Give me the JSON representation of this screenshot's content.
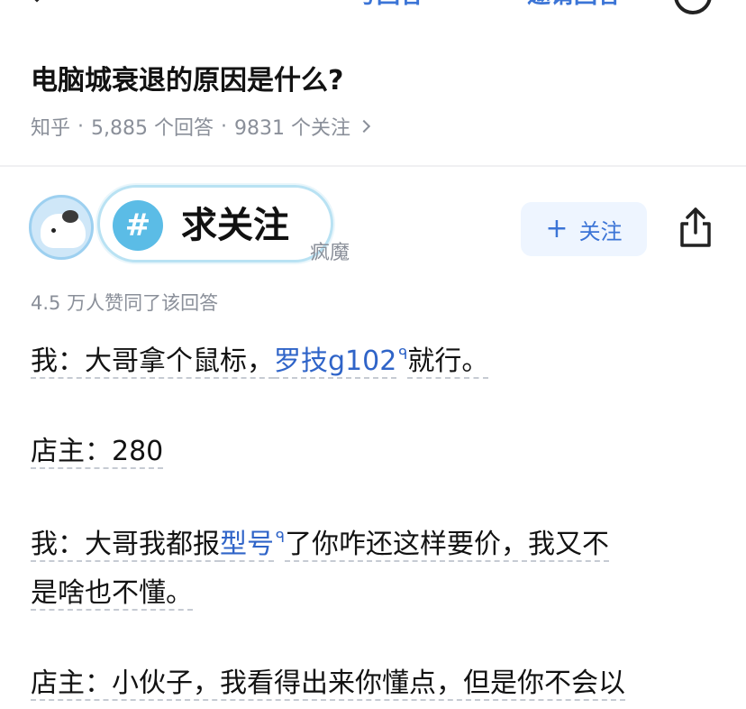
{
  "topbar": {
    "link1": "写回答",
    "link2": "邀请回答"
  },
  "question": {
    "title": "电脑城衰退的原因是什么?",
    "source": "知乎",
    "answers": "5,885 个回答",
    "followers": "9831 个关注"
  },
  "author": {
    "sticker_hash": "#",
    "sticker_text": "求关注",
    "name_suffix": "疯魔",
    "follow_label": "关注",
    "upvotes": "4.5 万人赞同了该回答"
  },
  "answer": {
    "p1_prefix": "我：大哥拿个鼠标，",
    "p1_link": "罗技g102",
    "p1_suffix": "就行。",
    "p2": "店主：280",
    "p3_prefix": "我：大哥我都报",
    "p3_link": "型号",
    "p3_suffix": "了你咋还这样要价，我又不",
    "p3_line2": "是啥也不懂。",
    "p4": "店主：小伙子，我看得出来你懂点，但是你不会以"
  },
  "colors": {
    "link": "#2f64c8",
    "meta": "#8a8f99",
    "badge": "#5bbce6"
  }
}
